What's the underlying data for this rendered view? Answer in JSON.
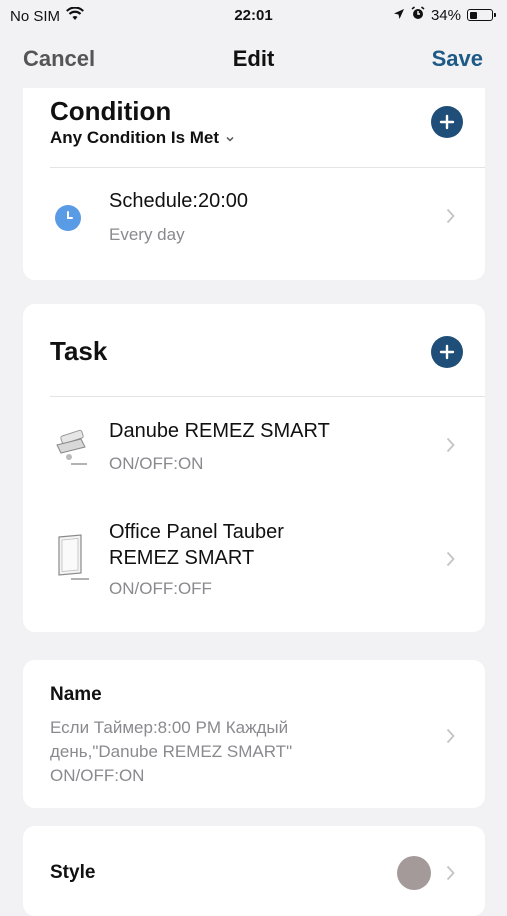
{
  "status_bar": {
    "carrier": "No SIM",
    "time": "22:01",
    "battery_percent": "34%",
    "battery_level": 0.34,
    "icons": [
      "wifi-icon",
      "location-icon",
      "alarm-icon",
      "battery-icon"
    ]
  },
  "nav": {
    "cancel_label": "Cancel",
    "title": "Edit",
    "save_label": "Save",
    "save_color": "#1e5a86"
  },
  "condition": {
    "title": "Condition",
    "mode": "Any Condition Is Met",
    "items": [
      {
        "title": "Schedule:20:00",
        "subtitle": "Every day",
        "icon": "clock-icon"
      }
    ]
  },
  "task": {
    "title": "Task",
    "items": [
      {
        "title": "Danube REMEZ SMART",
        "subtitle": "ON/OFF:ON",
        "icon": "device-thumbnail"
      },
      {
        "title_line1": "Office Panel Tauber",
        "title_line2": "REMEZ SMART",
        "subtitle": "ON/OFF:OFF",
        "icon": "device-thumbnail"
      }
    ]
  },
  "name": {
    "label": "Name",
    "value": "Если Таймер:8:00 PM Каждый день,\"Danube REMEZ SMART\" ON/OFF:ON"
  },
  "style": {
    "label": "Style",
    "swatch_color": "#a49a99"
  },
  "accent_color": "#1f4f78"
}
